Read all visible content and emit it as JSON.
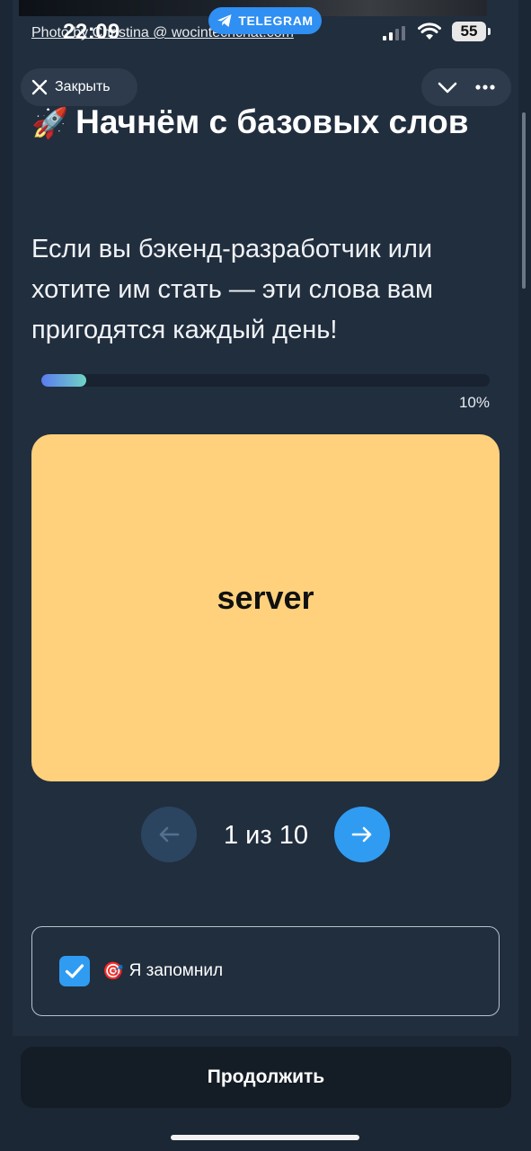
{
  "status_bar": {
    "photo_credit": "Photo by Christina @ wocintechchat.com",
    "time": "22:09",
    "telegram_label": "TELEGRAM",
    "battery": "55"
  },
  "header": {
    "close_label": "Закрыть"
  },
  "content": {
    "title_emoji": "🚀",
    "title": "Начнём с базовых слов",
    "subtitle": "Если вы бэкенд-разработчик или хотите им стать — эти слова вам пригодятся каждый день!",
    "progress": {
      "value": 0.1,
      "label": "10%"
    },
    "card": {
      "word": "server"
    },
    "navigation": {
      "counter": "1 из 10"
    },
    "remember": {
      "emoji": "🎯",
      "label": "Я запомнил",
      "checked": true
    }
  },
  "footer": {
    "continue_label": "Продолжить"
  },
  "colors": {
    "background": "#1b2735",
    "card": "#ffd17c",
    "accent": "#2f9cf2"
  }
}
